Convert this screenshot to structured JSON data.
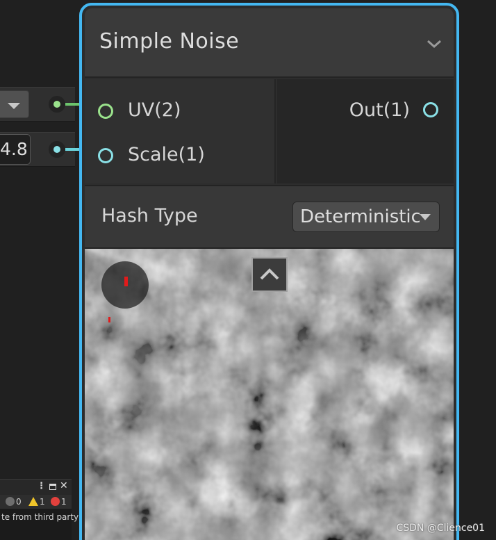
{
  "node": {
    "title": "Simple Noise",
    "collapse_icon": "chevron-down-icon",
    "inputs": [
      {
        "label": "UV(2)",
        "color": "#9ae28c"
      },
      {
        "label": "Scale(1)",
        "color": "#8ae0e6"
      }
    ],
    "outputs": [
      {
        "label": "Out(1)",
        "color": "#8ae0e6"
      }
    ],
    "settings": {
      "hash_type_label": "Hash Type",
      "hash_type_value": "Deterministic"
    },
    "preview_toggle_icon": "chevron-up-icon",
    "accent_color": "#44b8f2"
  },
  "connected_inputs": {
    "uv_dropdown_icon": "triangle-down-icon",
    "scale_value": "4.8"
  },
  "console": {
    "menu_icon": "more-vertical-icon",
    "maximize_icon": "maximize-icon",
    "close_icon": "close-icon",
    "info_count": "0",
    "warning_count": "1",
    "error_count": "1",
    "message": "te from third party"
  },
  "watermark": "CSDN @Clience01"
}
